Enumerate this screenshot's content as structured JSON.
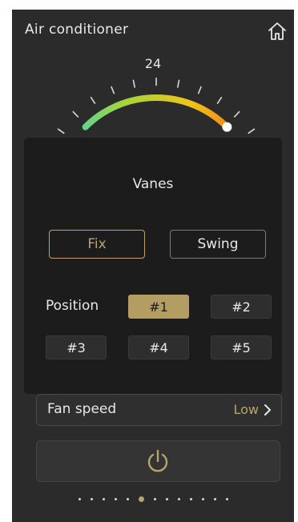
{
  "header": {
    "title": "Air conditioner",
    "home_icon": "home-icon"
  },
  "thermostat": {
    "setpoint": "24",
    "level": 1.0,
    "gradient": [
      "#3cd6b4",
      "#a8d33a",
      "#f0c419",
      "#f26b1d"
    ]
  },
  "vanes_dialog": {
    "title": "Vanes",
    "modes": [
      {
        "label": "Fix",
        "selected": true
      },
      {
        "label": "Swing",
        "selected": false
      }
    ],
    "position_label": "Position",
    "positions": [
      {
        "label": "#1",
        "selected": true
      },
      {
        "label": "#2",
        "selected": false
      },
      {
        "label": "#3",
        "selected": false
      },
      {
        "label": "#4",
        "selected": false
      },
      {
        "label": "#5",
        "selected": false
      }
    ]
  },
  "fan_speed": {
    "label": "Fan speed",
    "value": "Low"
  },
  "power": {
    "icon": "power-icon"
  },
  "pager": {
    "count": 13,
    "active_index": 5
  },
  "colors": {
    "accent": "#b9a46a",
    "background": "#2b2b2b",
    "dialog": "#1c1c1c"
  }
}
